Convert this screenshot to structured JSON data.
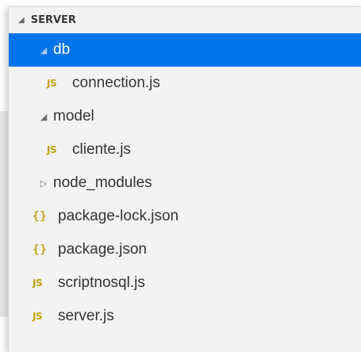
{
  "explorer": {
    "section_title": "SERVER",
    "section_twisty": "◢",
    "accent_color": "#0074e8",
    "js_icon_color": "#c0a30f",
    "items": [
      {
        "label": "db",
        "kind": "folder",
        "twisty": "◢",
        "depth": 1,
        "selected": true
      },
      {
        "label": "connection.js",
        "kind": "js-file",
        "icon": "JS",
        "depth": 2
      },
      {
        "label": "model",
        "kind": "folder",
        "twisty": "◢",
        "depth": 1
      },
      {
        "label": "cliente.js",
        "kind": "js-file",
        "icon": "JS",
        "depth": 2
      },
      {
        "label": "node_modules",
        "kind": "folder",
        "twisty": "▷",
        "depth": 1
      },
      {
        "label": "package-lock.json",
        "kind": "json-file",
        "icon": "{}",
        "depth": 1
      },
      {
        "label": "package.json",
        "kind": "json-file",
        "icon": "{}",
        "depth": 1
      },
      {
        "label": "scriptnosql.js",
        "kind": "js-file",
        "icon": "JS",
        "depth": 1
      },
      {
        "label": "server.js",
        "kind": "js-file",
        "icon": "JS",
        "depth": 1
      }
    ]
  }
}
